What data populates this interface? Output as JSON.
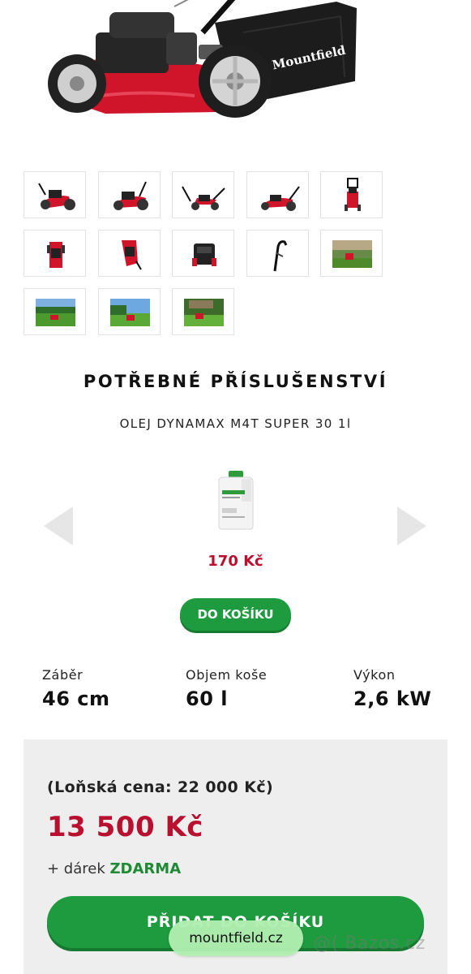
{
  "hero": {
    "brand_text": "Mountfield"
  },
  "thumbnails": [
    {
      "kind": "mower-angle-1"
    },
    {
      "kind": "mower-angle-2"
    },
    {
      "kind": "mower-side"
    },
    {
      "kind": "mower-side-2"
    },
    {
      "kind": "mower-front"
    },
    {
      "kind": "mower-rear"
    },
    {
      "kind": "mower-top"
    },
    {
      "kind": "engine-detail"
    },
    {
      "kind": "handle-detail"
    },
    {
      "kind": "garden-photo-1"
    },
    {
      "kind": "garden-photo-2"
    },
    {
      "kind": "garden-photo-3"
    },
    {
      "kind": "garden-photo-4"
    }
  ],
  "accessories": {
    "title": "POTŘEBNÉ PŘÍSLUŠENSTVÍ",
    "product_name": "OLEJ DYNAMAX M4T SUPER 30 1l",
    "price": "170 Kč",
    "cart_button": "DO KOŠÍKU",
    "prev_icon": "chevron-left-icon",
    "next_icon": "chevron-right-icon"
  },
  "specs": [
    {
      "label": "Záběr",
      "value": "46 cm"
    },
    {
      "label": "Objem koše",
      "value": "60 l"
    },
    {
      "label": "Výkon",
      "value": "2,6 kW"
    }
  ],
  "pricing": {
    "old_price": "(Loňská cena: 22 000 Kč)",
    "new_price": "13 500 Kč",
    "gift_prefix": "+ dárek",
    "gift_highlight": "ZDARMA",
    "add_to_cart": "PŘIDAT DO KOŠÍKU"
  },
  "overlay": {
    "domain": "mountfield.cz",
    "watermark": "@( Bazos.cz"
  },
  "colors": {
    "accent_green": "#1f9b3f",
    "price_red": "#b8102e",
    "mower_red": "#d0142a"
  }
}
